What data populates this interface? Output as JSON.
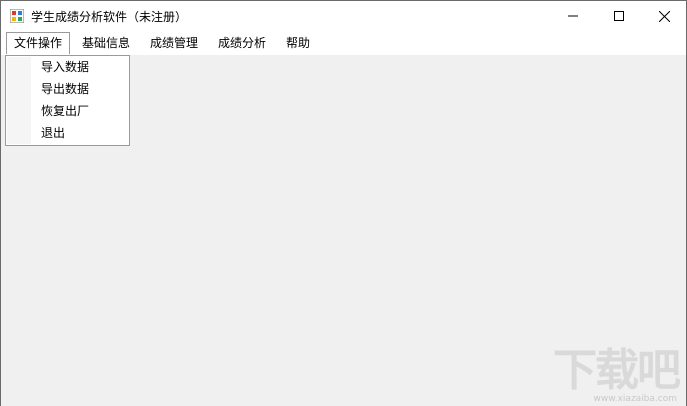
{
  "window": {
    "title": "学生成绩分析软件（未注册）"
  },
  "menubar": {
    "items": [
      {
        "label": "文件操作",
        "active": true
      },
      {
        "label": "基础信息"
      },
      {
        "label": "成绩管理"
      },
      {
        "label": "成绩分析"
      },
      {
        "label": "帮助"
      }
    ]
  },
  "file_menu": {
    "items": [
      {
        "label": "导入数据"
      },
      {
        "label": "导出数据"
      },
      {
        "label": "恢复出厂"
      },
      {
        "label": "退出"
      }
    ]
  },
  "watermark": {
    "main": "下载吧",
    "sub": "www.xiazaiba.com"
  },
  "colors": {
    "client_bg": "#f0f0f0",
    "titlebar_bg": "#ffffff",
    "menu_border": "#9a9a9a"
  }
}
